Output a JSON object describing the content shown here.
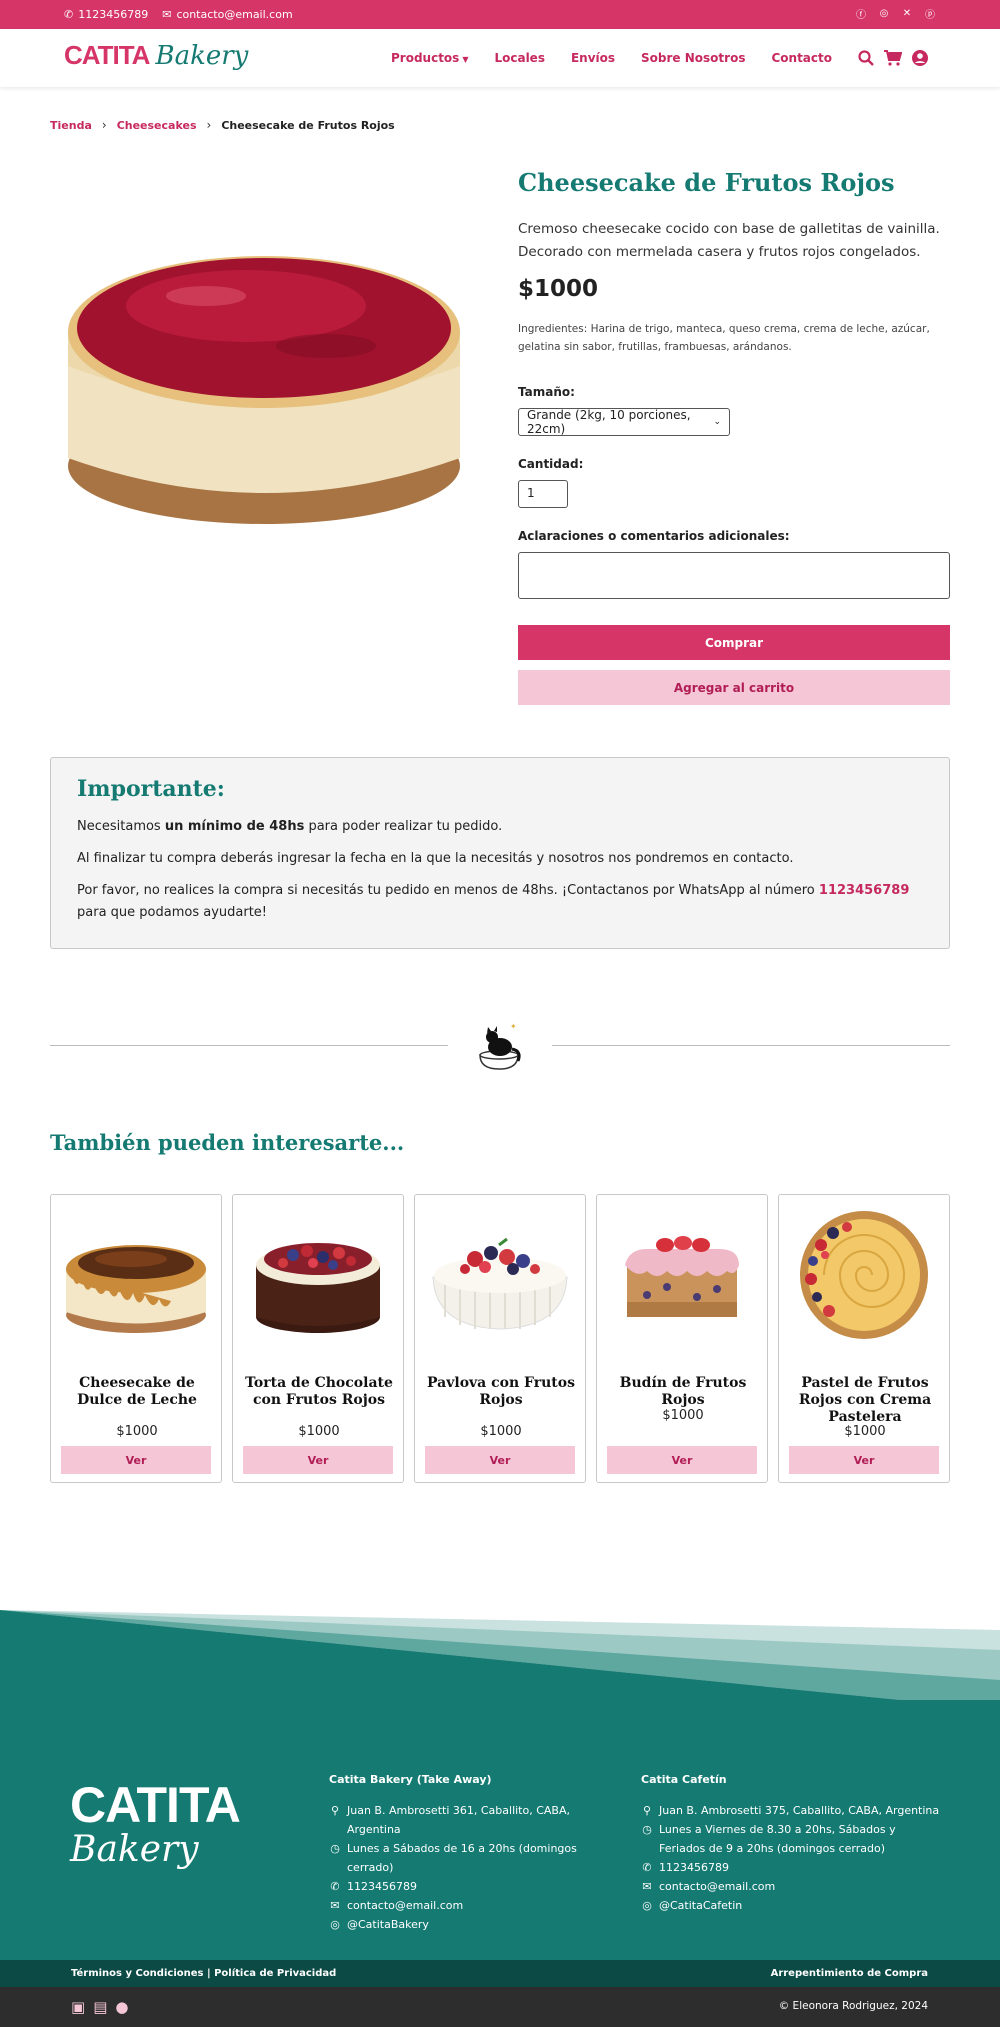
{
  "topbar": {
    "phone": "1123456789",
    "email": "contacto@email.com",
    "social": [
      "facebook-icon",
      "instagram-icon",
      "x-icon",
      "pinterest-icon"
    ]
  },
  "brand": {
    "word1": "CATITA",
    "word2": "Bakery"
  },
  "nav": {
    "items": [
      "Productos",
      "Locales",
      "Envíos",
      "Sobre Nosotros",
      "Contacto"
    ]
  },
  "breadcrumb": {
    "items": [
      "Tienda",
      "Cheesecakes",
      "Cheesecake de Frutos Rojos"
    ]
  },
  "product": {
    "title": "Cheesecake de Frutos Rojos",
    "description": "Cremoso cheesecake cocido con base de galletitas de vainilla. Decorado con mermelada casera y frutos rojos congelados.",
    "price": "$1000",
    "ingredients": "Ingredientes: Harina de trigo, manteca, queso crema, crema de leche, azúcar, gelatina sin sabor, frutillas, frambuesas, arándanos.",
    "size_label": "Tamaño:",
    "size_value": "Grande (2kg, 10 porciones, 22cm)",
    "qty_label": "Cantidad:",
    "qty_value": "1",
    "comments_label": "Aclaraciones o comentarios adicionales:",
    "buy_label": "Comprar",
    "cart_label": "Agregar al carrito"
  },
  "important": {
    "title": "Importante:",
    "p1_pre": "Necesitamos ",
    "p1_bold": "un mínimo de 48hs",
    "p1_post": " para poder realizar tu pedido.",
    "p2": "Al finalizar tu compra deberás ingresar la fecha en la que la necesitás y nosotros nos pondremos en contacto.",
    "p3_pre": "Por favor, no realices la compra si necesitás tu pedido en menos de 48hs. ¡Contactanos por WhatsApp al número ",
    "p3_phone": "1123456789",
    "p3_post": " para que podamos ayudarte!"
  },
  "related": {
    "title": "También pueden interesarte...",
    "view_label": "Ver",
    "items": [
      {
        "name": "Cheesecake de Dulce de Leche",
        "price": "$1000"
      },
      {
        "name": "Torta de Chocolate con Frutos Rojos",
        "price": "$1000"
      },
      {
        "name": "Pavlova con Frutos Rojos",
        "price": "$1000"
      },
      {
        "name": "Budín de Frutos Rojos",
        "price": "$1000"
      },
      {
        "name": "Pastel de Frutos Rojos con Crema Pastelera",
        "price": "$1000"
      }
    ]
  },
  "footer": {
    "col1": {
      "title": "Catita Bakery (Take Away)",
      "address": "Juan B. Ambrosetti 361, Caballito, CABA, Argentina",
      "hours": "Lunes a Sábados de 16 a 20hs (domingos cerrado)",
      "phone": "1123456789",
      "email": "contacto@email.com",
      "instagram": "@CatitaBakery"
    },
    "col2": {
      "title": "Catita Cafetín",
      "address": "Juan B. Ambrosetti 375, Caballito, CABA, Argentina",
      "hours": "Lunes a Viernes de 8.30 a 20hs, Sábados y Feriados de 9 a 20hs (domingos cerrado)",
      "phone": "1123456789",
      "email": "contacto@email.com",
      "instagram": "@CatitaCafetin"
    },
    "terms": "Términos y Condiciones | Política de Privacidad",
    "regret": "Arrepentimiento de Compra",
    "copyright": "© Eleonora Rodriguez, 2024"
  },
  "colors": {
    "primary": "#d63568",
    "teal": "#147a72",
    "pink_light": "#f5c6d6"
  }
}
